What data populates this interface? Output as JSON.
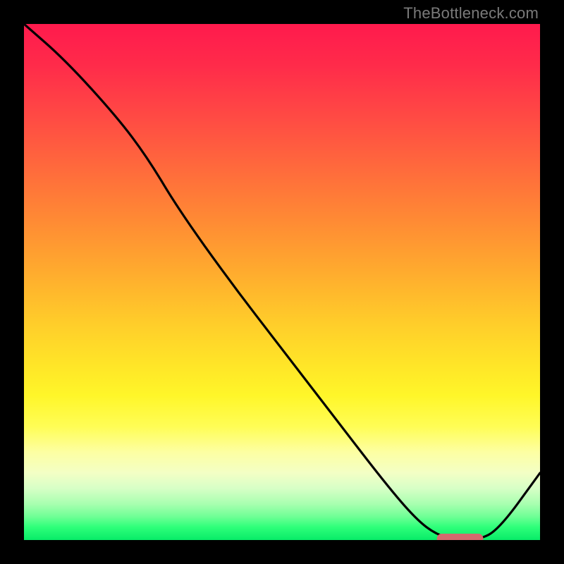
{
  "watermark": {
    "text": "TheBottleneck.com"
  },
  "chart_data": {
    "type": "line",
    "title": "",
    "xlabel": "",
    "ylabel": "",
    "xlim": [
      0,
      100
    ],
    "ylim": [
      0,
      100
    ],
    "grid": false,
    "legend": false,
    "series": [
      {
        "name": "bottleneck-curve",
        "x": [
          0,
          8,
          18,
          24,
          30,
          40,
          50,
          60,
          70,
          76,
          80,
          84,
          88,
          92,
          100
        ],
        "values": [
          100,
          93,
          82,
          74,
          64,
          50,
          37,
          24,
          11,
          4,
          1,
          0,
          0,
          2,
          13
        ]
      }
    ],
    "min_plateau": {
      "x_start": 80,
      "x_end": 89,
      "y": 0
    },
    "background_gradient": {
      "top": "#ff1a4d",
      "mid": "#ffe528",
      "bottom": "#08eb68"
    }
  }
}
